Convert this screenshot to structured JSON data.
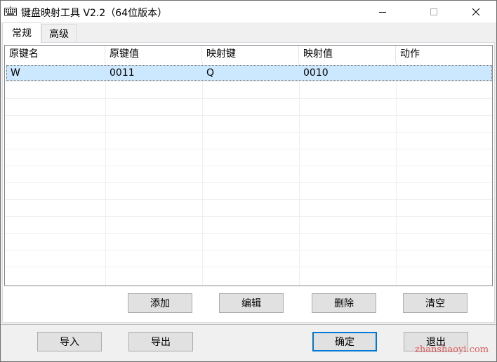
{
  "window": {
    "title": "键盘映射工具 V2.2（64位版本）",
    "minimize_label": "—",
    "maximize_label": "☐",
    "close_label": "✕"
  },
  "tabs": [
    {
      "label": "常规",
      "active": true
    },
    {
      "label": "高级",
      "active": false
    }
  ],
  "table": {
    "columns": [
      "原键名",
      "原键值",
      "映射键",
      "映射值",
      "动作"
    ],
    "rows": [
      {
        "original_name": "W",
        "original_value": "0011",
        "mapped_key": "Q",
        "mapped_value": "0010",
        "action": ""
      }
    ]
  },
  "actions": {
    "add": "添加",
    "edit": "编辑",
    "delete": "删除",
    "clear": "清空"
  },
  "footer": {
    "import": "导入",
    "export": "导出",
    "ok": "确定",
    "exit": "退出"
  },
  "watermark": "zhanshaoyi.com",
  "colors": {
    "selection": "#cce8ff",
    "default_button_border": "#0078d7",
    "watermark": "#e05a5a"
  }
}
